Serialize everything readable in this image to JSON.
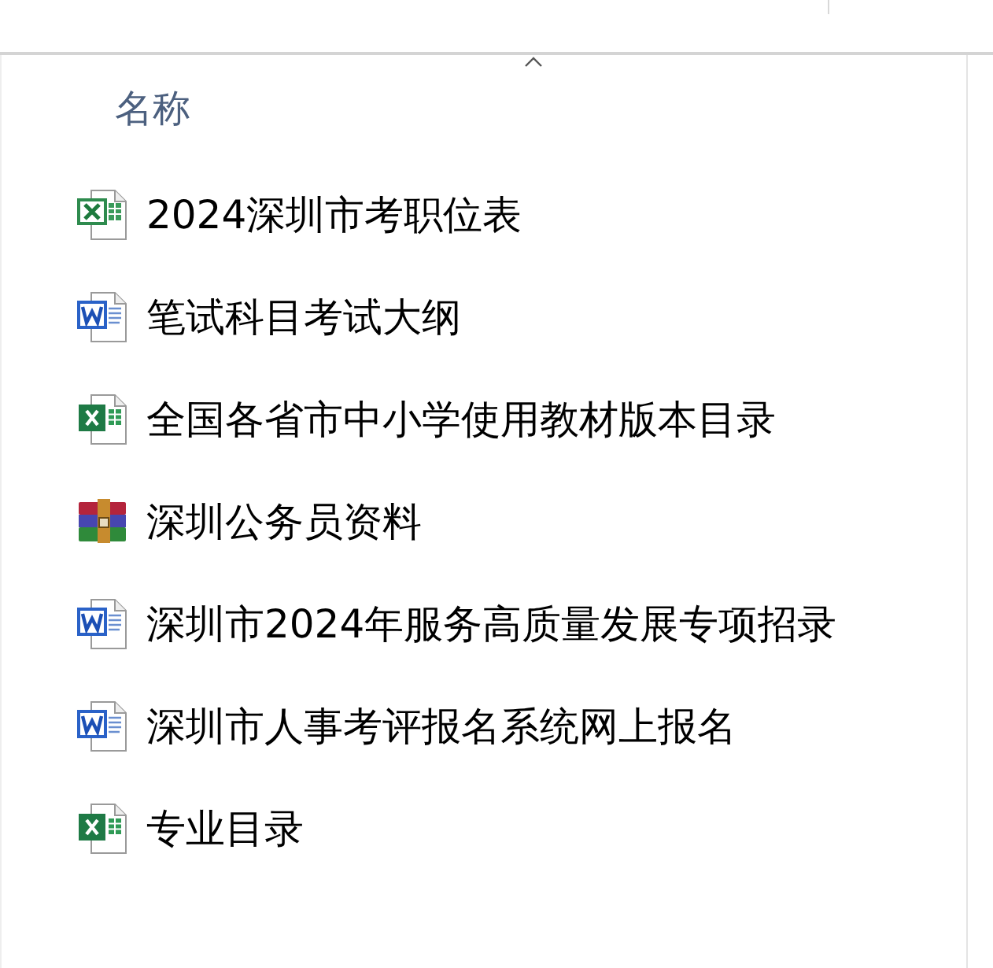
{
  "column_header": {
    "label": "名称",
    "sort_ascending": true
  },
  "files": [
    {
      "name": "2024深圳市考职位表",
      "kind": "xls"
    },
    {
      "name": "笔试科目考试大纲",
      "kind": "doc"
    },
    {
      "name": "全国各省市中小学使用教材版本目录",
      "kind": "xlsx"
    },
    {
      "name": "深圳公务员资料",
      "kind": "rar"
    },
    {
      "name": "深圳市2024年服务高质量发展专项招录",
      "kind": "doc"
    },
    {
      "name": "深圳市人事考评报名系统网上报名",
      "kind": "doc"
    },
    {
      "name": "专业目录",
      "kind": "xlsx"
    }
  ]
}
